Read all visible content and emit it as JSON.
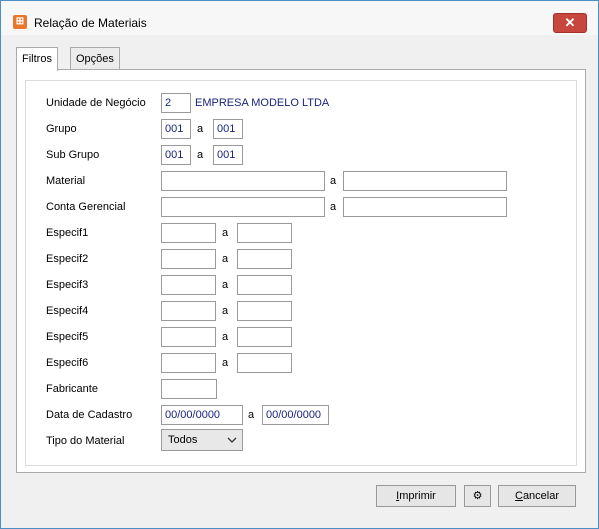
{
  "window": {
    "title": "Relação de Materiais",
    "close_glyph": "✕"
  },
  "tabs": [
    {
      "label": "Filtros"
    },
    {
      "label": "Opções"
    }
  ],
  "form": {
    "unidade": {
      "label": "Unidade de Negócio",
      "value": "2",
      "company": "EMPRESA MODELO LTDA"
    },
    "grupo": {
      "label": "Grupo",
      "from": "001",
      "sep": "a",
      "to": "001"
    },
    "subgrupo": {
      "label": "Sub Grupo",
      "from": "001",
      "sep": "a",
      "to": "001"
    },
    "material": {
      "label": "Material",
      "from": "",
      "sep": "a",
      "to": ""
    },
    "conta": {
      "label": "Conta Gerencial",
      "from": "",
      "sep": "a",
      "to": ""
    },
    "especif": [
      {
        "label": "Especif1",
        "from": "",
        "sep": "a",
        "to": ""
      },
      {
        "label": "Especif2",
        "from": "",
        "sep": "a",
        "to": ""
      },
      {
        "label": "Especif3",
        "from": "",
        "sep": "a",
        "to": ""
      },
      {
        "label": "Especif4",
        "from": "",
        "sep": "a",
        "to": ""
      },
      {
        "label": "Especif5",
        "from": "",
        "sep": "a",
        "to": ""
      },
      {
        "label": "Especif6",
        "from": "",
        "sep": "a",
        "to": ""
      }
    ],
    "fabricante": {
      "label": "Fabricante",
      "value": ""
    },
    "data": {
      "label": "Data de Cadastro",
      "from": "00/00/0000",
      "sep": "a",
      "to": "00/00/0000"
    },
    "tipo": {
      "label": "Tipo do Material",
      "selected": "Todos"
    }
  },
  "buttons": {
    "imprimir_u": "I",
    "imprimir_rest": "mprimir",
    "settings_icon": "gear-icon",
    "settings_glyph": "⚙",
    "cancelar_u": "C",
    "cancelar_rest": "ancelar"
  },
  "colors": {
    "value_text": "#1a237e",
    "close": "#c7463e",
    "app_icon": "#e8772e"
  }
}
